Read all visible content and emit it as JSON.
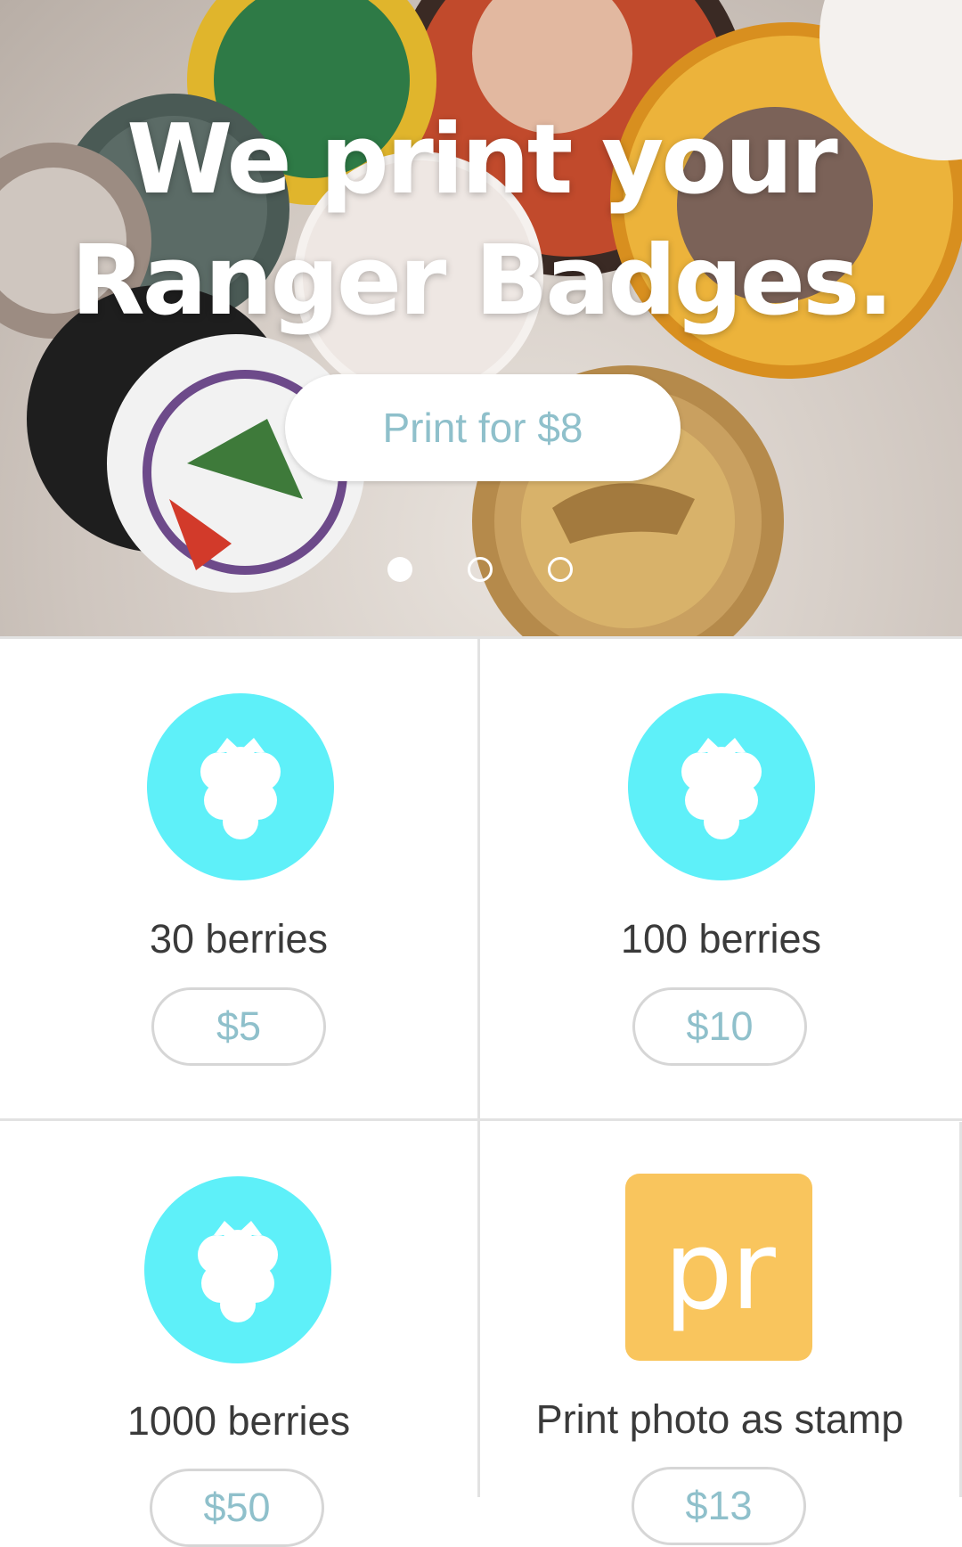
{
  "hero": {
    "title_line1": "We print your",
    "title_line2": "Ranger Badges.",
    "cta_label": "Print for $8",
    "carousel": {
      "count": 3,
      "active_index": 0
    }
  },
  "products": [
    {
      "icon": "raspberry-icon",
      "name": "30 berries",
      "price": "$5"
    },
    {
      "icon": "raspberry-icon",
      "name": "100 berries",
      "price": "$10"
    },
    {
      "icon": "raspberry-icon",
      "name": "1000 berries",
      "price": "$50"
    },
    {
      "icon_text": "pr",
      "name": "Print photo as stamp",
      "price": "$13"
    }
  ],
  "colors": {
    "accent_cyan": "#5ef0f9",
    "accent_orange": "#f9c55d",
    "price_text": "#8fc0cb"
  }
}
